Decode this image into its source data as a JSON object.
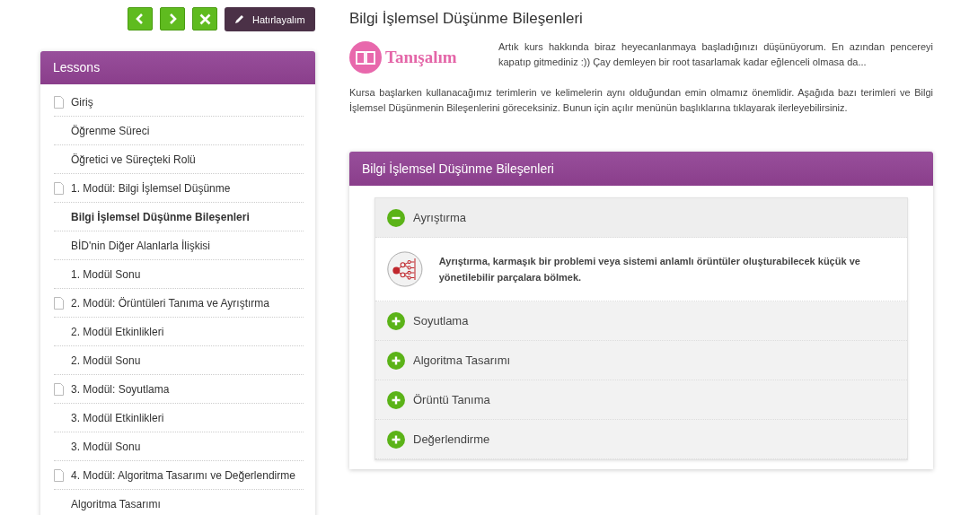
{
  "toolbar": {
    "buttons": [
      {
        "kind": "prev"
      },
      {
        "kind": "next"
      },
      {
        "kind": "close"
      },
      {
        "kind": "note",
        "label": "Hatırlayalım"
      }
    ]
  },
  "lessons": {
    "title": "Lessons",
    "items": [
      {
        "label": "Giriş",
        "kind": "module",
        "selected": false
      },
      {
        "label": "Öğrenme Süreci",
        "kind": "page",
        "selected": false
      },
      {
        "label": "Öğretici ve Süreçteki Rolü",
        "kind": "page",
        "selected": false
      },
      {
        "label": "1. Modül: Bilgi İşlemsel Düşünme",
        "kind": "module",
        "selected": false
      },
      {
        "label": "Bilgi İşlemsel Düşünme Bileşenleri",
        "kind": "page",
        "selected": true
      },
      {
        "label": "BİD'nin Diğer Alanlarla İlişkisi",
        "kind": "page",
        "selected": false
      },
      {
        "label": "1. Modül Sonu",
        "kind": "page",
        "selected": false
      },
      {
        "label": "2. Modül: Örüntüleri Tanıma ve Ayrıştırma",
        "kind": "module",
        "selected": false
      },
      {
        "label": "2. Modül Etkinlikleri",
        "kind": "page",
        "selected": false
      },
      {
        "label": "2. Modül Sonu",
        "kind": "page",
        "selected": false
      },
      {
        "label": "3. Modül: Soyutlama",
        "kind": "module",
        "selected": false
      },
      {
        "label": "3. Modül Etkinlikleri",
        "kind": "page",
        "selected": false
      },
      {
        "label": "3. Modül Sonu",
        "kind": "page",
        "selected": false
      },
      {
        "label": "4. Modül: Algoritma Tasarımı ve Değerlendirme",
        "kind": "module",
        "selected": false
      },
      {
        "label": "Algoritma Tasarımı",
        "kind": "page",
        "selected": false
      }
    ]
  },
  "content": {
    "title": "Bilgi İşlemsel Düşünme Bileşenleri",
    "logo": {
      "text": "Tanışalım"
    },
    "intro": "Artık kurs hakkında biraz heyecanlanmaya başladığınızı düşünüyorum. En azından pencereyi kapatıp gitmediniz :)) Çay demleyen bir root tasarlamak kadar eğlenceli olmasa da...",
    "paragraph": "Kursa başlarken kullanacağımız terimlerin ve kelimelerin aynı olduğundan emin olmamız önemlidir. Aşağıda bazı terimleri ve Bilgi İşlemsel Düşünmenin Bileşenlerini göreceksiniz. Bunun için açılır menünün başlıklarına tıklayarak ilerleyebilirsiniz.",
    "panel": {
      "title": "Bilgi İşlemsel Düşünme Bileşenleri",
      "sections": [
        {
          "title": "Ayrıştırma",
          "expanded": true,
          "body": "Ayrıştırma, karmaşık bir problemi veya sistemi anlamlı örüntüler oluşturabilecek küçük ve yönetilebilir parçalara bölmek."
        },
        {
          "title": "Soyutlama",
          "expanded": false
        },
        {
          "title": "Algoritma Tasarımı",
          "expanded": false
        },
        {
          "title": "Örüntü Tanıma",
          "expanded": false
        },
        {
          "title": "Değerlendirme",
          "expanded": false
        }
      ]
    }
  }
}
